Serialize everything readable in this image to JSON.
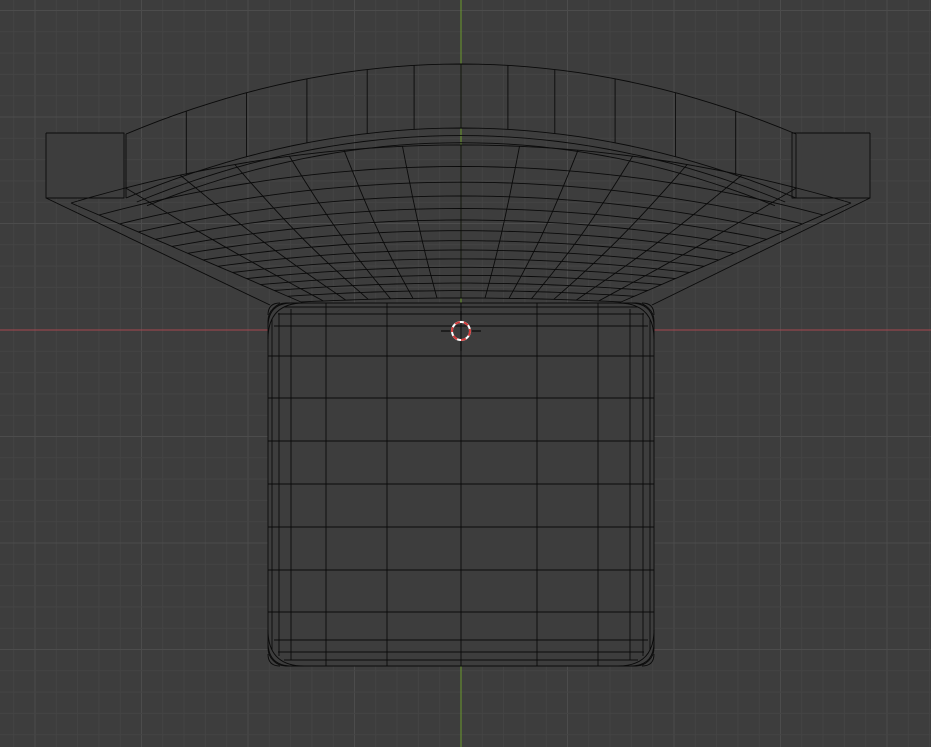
{
  "viewport": {
    "background": "#3d3d3d",
    "grid_minor_color": "#444444",
    "grid_major_color": "#4c4c4c",
    "x_axis_color": "#a8464f",
    "y_axis_color": "#6b9a2c"
  },
  "mesh": {
    "edge_color": "#0a0a0a",
    "face_color": "#3d3d3d",
    "display": "wireframe"
  },
  "cursor_3d": {
    "icon": "3d-cursor-icon",
    "ring_color_a": "#d63a3a",
    "ring_color_b": "#ffffff",
    "crosshair_color": "#000000"
  }
}
